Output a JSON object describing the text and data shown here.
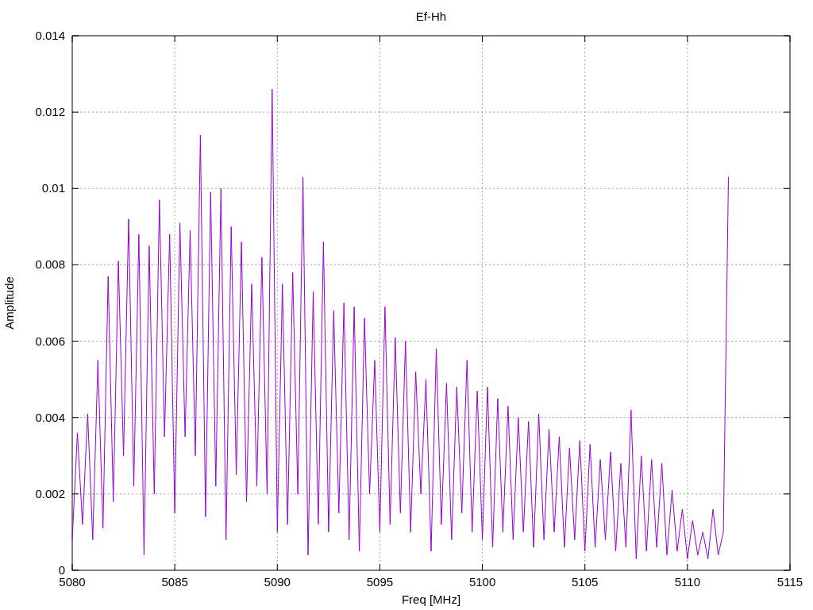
{
  "chart_data": {
    "type": "line",
    "title": "Ef-Hh",
    "xlabel": "Freq [MHz]",
    "ylabel": "Amplitude",
    "xlim": [
      5080,
      5115
    ],
    "ylim": [
      0,
      0.014
    ],
    "xticks": [
      5080,
      5085,
      5090,
      5095,
      5100,
      5105,
      5110,
      5115
    ],
    "yticks": [
      {
        "value": 0,
        "label": "0"
      },
      {
        "value": 0.002,
        "label": "0.002"
      },
      {
        "value": 0.004,
        "label": "0.004"
      },
      {
        "value": 0.006,
        "label": "0.006"
      },
      {
        "value": 0.008,
        "label": "0.008"
      },
      {
        "value": 0.01,
        "label": "0.01"
      },
      {
        "value": 0.012,
        "label": "0.012"
      },
      {
        "value": 0.014,
        "label": "0.014"
      }
    ],
    "x": [
      5080,
      5080.25,
      5080.5,
      5080.75,
      5081,
      5081.25,
      5081.5,
      5081.75,
      5082,
      5082.25,
      5082.5,
      5082.75,
      5083,
      5083.25,
      5083.5,
      5083.75,
      5084,
      5084.25,
      5084.5,
      5084.75,
      5085,
      5085.25,
      5085.5,
      5085.75,
      5086,
      5086.25,
      5086.5,
      5086.75,
      5087,
      5087.25,
      5087.5,
      5087.75,
      5088,
      5088.25,
      5088.5,
      5088.75,
      5089,
      5089.25,
      5089.5,
      5089.75,
      5090,
      5090.25,
      5090.5,
      5090.75,
      5091,
      5091.25,
      5091.5,
      5091.75,
      5092,
      5092.25,
      5092.5,
      5092.75,
      5093,
      5093.25,
      5093.5,
      5093.75,
      5094,
      5094.25,
      5094.5,
      5094.75,
      5095,
      5095.25,
      5095.5,
      5095.75,
      5096,
      5096.25,
      5096.5,
      5096.75,
      5097,
      5097.25,
      5097.5,
      5097.75,
      5098,
      5098.25,
      5098.5,
      5098.75,
      5099,
      5099.25,
      5099.5,
      5099.75,
      5100,
      5100.25,
      5100.5,
      5100.75,
      5101,
      5101.25,
      5101.5,
      5101.75,
      5102,
      5102.25,
      5102.5,
      5102.75,
      5103,
      5103.25,
      5103.5,
      5103.75,
      5104,
      5104.25,
      5104.5,
      5104.75,
      5105,
      5105.25,
      5105.5,
      5105.75,
      5106,
      5106.25,
      5106.5,
      5106.75,
      5107,
      5107.25,
      5107.5,
      5107.75,
      5108,
      5108.25,
      5108.5,
      5108.75,
      5109,
      5109.25,
      5109.5,
      5109.75,
      5110,
      5110.25,
      5110.5,
      5110.75,
      5111,
      5111.25,
      5111.5,
      5111.75,
      5112
    ],
    "grid": true,
    "series": [
      {
        "color": "#9400d3",
        "values": [
          0.0008,
          0.0036,
          0.0012,
          0.0041,
          0.0008,
          0.0055,
          0.0011,
          0.0077,
          0.0018,
          0.0081,
          0.003,
          0.0092,
          0.0022,
          0.0088,
          0.0004,
          0.0085,
          0.002,
          0.0097,
          0.0035,
          0.0088,
          0.0015,
          0.0091,
          0.0035,
          0.0089,
          0.003,
          0.0114,
          0.0014,
          0.0099,
          0.0022,
          0.01,
          0.0008,
          0.009,
          0.0025,
          0.0086,
          0.0018,
          0.0075,
          0.0022,
          0.0082,
          0.002,
          0.0126,
          0.001,
          0.0075,
          0.0012,
          0.0078,
          0.002,
          0.0103,
          0.0004,
          0.0073,
          0.0012,
          0.0086,
          0.001,
          0.0068,
          0.0015,
          0.007,
          0.0008,
          0.0069,
          0.0005,
          0.0066,
          0.002,
          0.0055,
          0.001,
          0.0069,
          0.0012,
          0.0061,
          0.0015,
          0.006,
          0.001,
          0.0052,
          0.002,
          0.005,
          0.0005,
          0.0058,
          0.0012,
          0.0049,
          0.0008,
          0.0048,
          0.0015,
          0.0055,
          0.001,
          0.0047,
          0.0008,
          0.0048,
          0.0006,
          0.0045,
          0.001,
          0.0043,
          0.0008,
          0.004,
          0.001,
          0.0039,
          0.0006,
          0.0041,
          0.0008,
          0.0037,
          0.001,
          0.0035,
          0.0006,
          0.0032,
          0.0008,
          0.0034,
          0.0005,
          0.0033,
          0.0006,
          0.0029,
          0.0008,
          0.0031,
          0.0005,
          0.0028,
          0.0006,
          0.0042,
          0.0003,
          0.003,
          0.0005,
          0.0029,
          0.0006,
          0.0028,
          0.0004,
          0.0021,
          0.0005,
          0.0016,
          0.0003,
          0.0013,
          0.0004,
          0.001,
          0.0003,
          0.0016,
          0.0004,
          0.001,
          0.0103
        ]
      }
    ]
  }
}
